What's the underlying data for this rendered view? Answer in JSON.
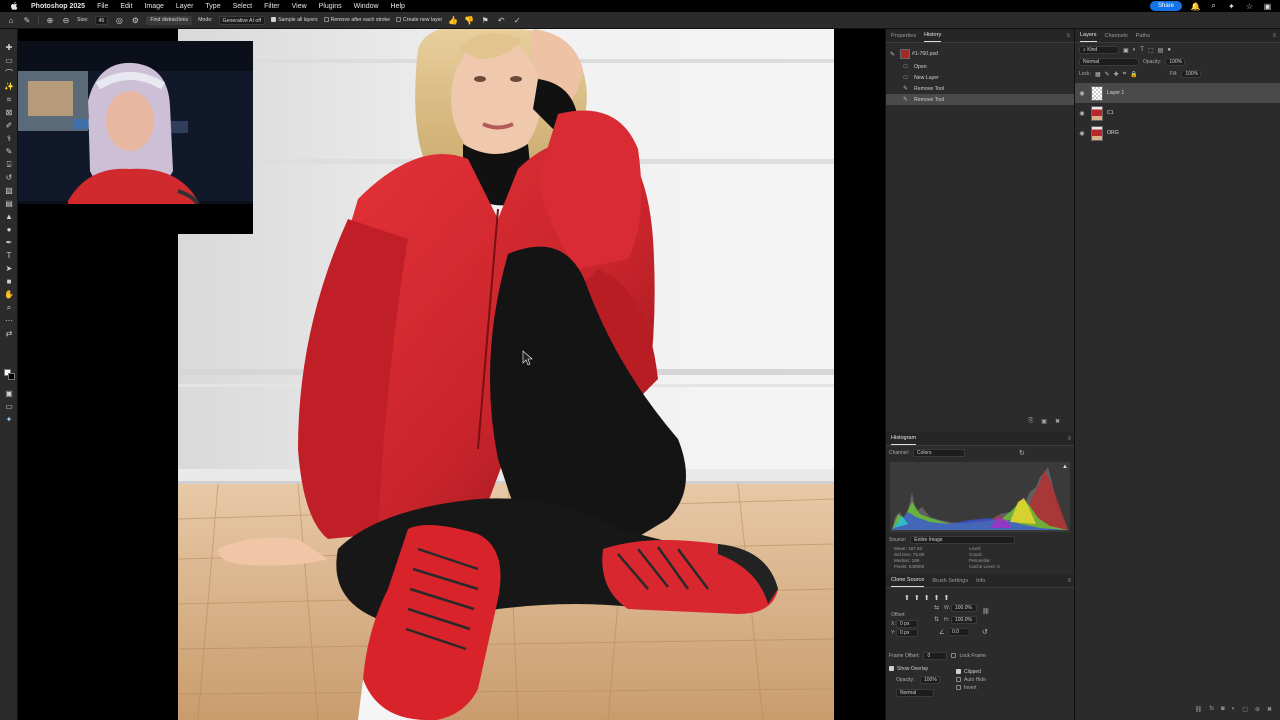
{
  "menubar": {
    "app_name": "Photoshop 2025",
    "items": [
      "File",
      "Edit",
      "Image",
      "Layer",
      "Type",
      "Select",
      "Filter",
      "View",
      "Plugins",
      "Window",
      "Help"
    ],
    "share_label": "Share"
  },
  "options": {
    "size_label": "Size:",
    "size_value": "45",
    "find_distractions": "Find distractions",
    "mode_label": "Mode:",
    "mode_value": "Generative AI off",
    "sample_all_layers": "Sample all layers",
    "remove_after_stroke": "Remove after each stroke",
    "create_new_layer": "Create new layer"
  },
  "panel_mid": {
    "tabs": [
      "Properties",
      "History"
    ],
    "active_tab": "History",
    "doc_name": "#1-760.psd",
    "history": [
      {
        "label": "Open"
      },
      {
        "label": "New Layer"
      },
      {
        "label": "Remove Tool"
      },
      {
        "label": "Remove Tool"
      }
    ],
    "histogram": {
      "title": "Histogram",
      "channel_label": "Channel:",
      "channel_value": "Colors",
      "source_label": "Source:",
      "source_value": "Entire Image",
      "stats_left": [
        {
          "k": "Mean:",
          "v": "167.93"
        },
        {
          "k": "Std Dev:",
          "v": "75.86"
        },
        {
          "k": "Median:",
          "v": "199"
        },
        {
          "k": "Pixels:",
          "v": "640000"
        }
      ],
      "stats_right": [
        {
          "k": "Level:",
          "v": ""
        },
        {
          "k": "Count:",
          "v": ""
        },
        {
          "k": "Percentile:",
          "v": ""
        },
        {
          "k": "Cache Level:",
          "v": "6"
        }
      ]
    },
    "clone_source": {
      "tabs": [
        "Clone Source",
        "Brush Settings",
        "Info"
      ],
      "offset_label": "Offset:",
      "x_label": "X:",
      "x_value": "0 px",
      "y_label": "Y:",
      "y_value": "0 px",
      "w_label": "W:",
      "w_value": "100.0%",
      "h_label": "H:",
      "h_value": "100.0%",
      "angle_value": "0.0",
      "frame_offset_label": "Frame Offset:",
      "frame_offset_value": "0",
      "lock_frame": "Lock Frame",
      "show_overlay": "Show Overlay",
      "clipped": "Clipped",
      "auto_hide": "Auto Hide",
      "invert": "Invert",
      "opacity_label": "Opacity:",
      "opacity_value": "100%",
      "blend_value": "Normal"
    }
  },
  "layers_panel": {
    "tabs": [
      "Layers",
      "Channels",
      "Paths"
    ],
    "filter_value": "Kind",
    "blend_mode": "Normal",
    "opacity_label": "Opacity:",
    "opacity_value": "100%",
    "lock_label": "Lock:",
    "fill_label": "Fill:",
    "fill_value": "100%",
    "layers": [
      {
        "name": "Layer 1",
        "selected": true
      },
      {
        "name": "C1",
        "selected": false
      },
      {
        "name": "ORG",
        "selected": false
      }
    ]
  },
  "colors": {
    "accent": "#1473e6",
    "panel": "#2b2b2b",
    "jacket_red": "#c8242b"
  }
}
